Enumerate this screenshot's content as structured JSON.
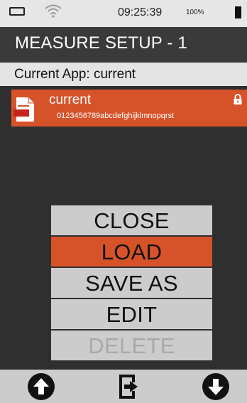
{
  "status": {
    "time": "09:25:39",
    "battery_pct": "100%"
  },
  "header": {
    "title": "MEASURE SETUP - 1"
  },
  "current_app": {
    "label": "Current App:  current"
  },
  "app_item": {
    "name": "current",
    "description": "0123456789abcdefghijklmnopqrst",
    "icon": "document-icon",
    "lock": "lock-icon"
  },
  "menu": {
    "items": [
      {
        "label": "CLOSE"
      },
      {
        "label": "LOAD"
      },
      {
        "label": "SAVE AS"
      },
      {
        "label": "EDIT"
      },
      {
        "label": "DELETE"
      }
    ]
  },
  "colors": {
    "accent": "#d6532a",
    "background": "#2f2f2f",
    "panel": "#cccccc"
  },
  "bottom_nav": {
    "icons": [
      "arrow-up-circle-icon",
      "exit-icon",
      "arrow-down-circle-icon"
    ]
  }
}
